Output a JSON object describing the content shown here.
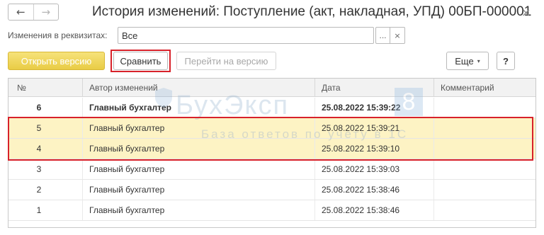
{
  "window": {
    "title": "История изменений: Поступление (акт, накладная, УПД) 00БП-000001",
    "close_glyph": "×"
  },
  "nav": {
    "back_glyph": "←",
    "forward_glyph": "→"
  },
  "filter": {
    "label": "Изменения в реквизитах:",
    "value": "Все",
    "select_glyph": "...",
    "clear_glyph": "×"
  },
  "toolbar": {
    "open_version_label": "Открыть версию",
    "compare_label": "Сравнить",
    "goto_version_label": "Перейти на версию",
    "more_label": "Еще",
    "more_caret": "▾",
    "help_label": "?"
  },
  "table": {
    "columns": [
      "№",
      "Автор изменений",
      "Дата",
      "Комментарий"
    ],
    "rows": [
      {
        "num": "6",
        "author": "Главный бухгалтер",
        "date": "25.08.2022 15:39:22",
        "comment": "",
        "bold": true,
        "highlighted": false
      },
      {
        "num": "5",
        "author": "Главный бухгалтер",
        "date": "25.08.2022 15:39:21",
        "comment": "",
        "bold": false,
        "highlighted": true
      },
      {
        "num": "4",
        "author": "Главный бухгалтер",
        "date": "25.08.2022 15:39:10",
        "comment": "",
        "bold": false,
        "highlighted": true
      },
      {
        "num": "3",
        "author": "Главный бухгалтер",
        "date": "25.08.2022 15:39:03",
        "comment": "",
        "bold": false,
        "highlighted": false
      },
      {
        "num": "2",
        "author": "Главный бухгалтер",
        "date": "25.08.2022 15:38:46",
        "comment": "",
        "bold": false,
        "highlighted": false
      },
      {
        "num": "1",
        "author": "Главный бухгалтер",
        "date": "25.08.2022 15:38:46",
        "comment": "",
        "bold": false,
        "highlighted": false
      }
    ]
  },
  "watermark": {
    "title": "БухЭксп",
    "badge": "8",
    "subtitle": "База ответов по учету в 1С"
  },
  "colors": {
    "accent_yellow": "#e9cc45",
    "highlight_row": "#fdf3c4",
    "annotation_red": "#d8222a"
  }
}
